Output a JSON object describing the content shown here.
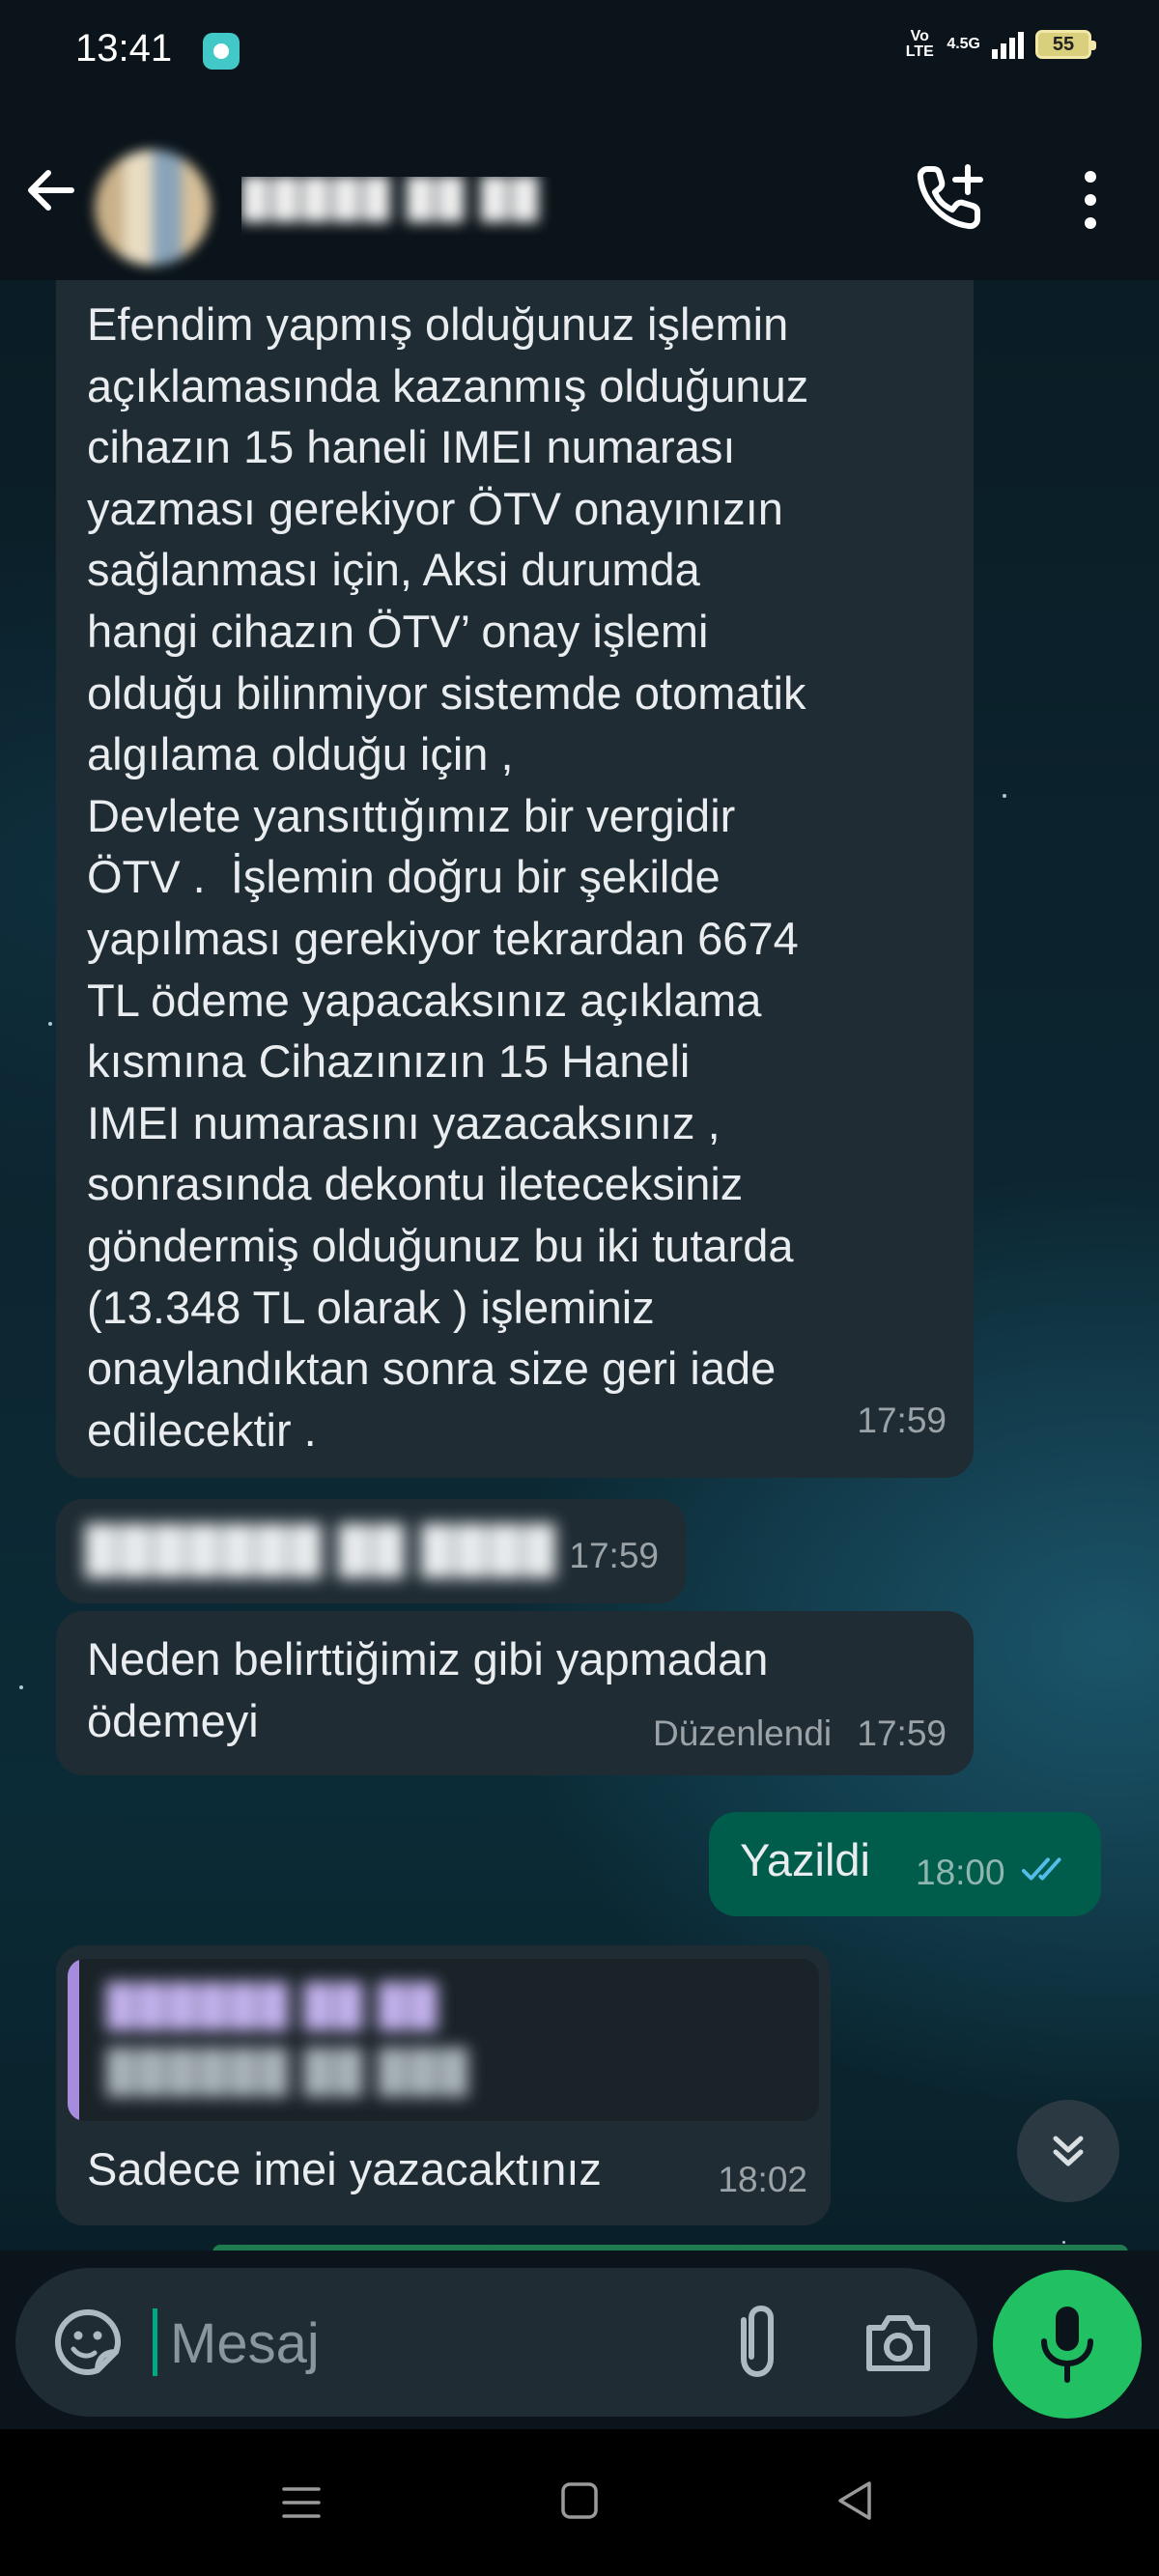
{
  "status_bar": {
    "time": "13:41",
    "volte": "Vo LTE",
    "network": "4.5G",
    "battery": "55"
  },
  "header": {
    "contact_name": "█████ ██ ██",
    "avatar_description": "blurred contact avatar"
  },
  "messages": [
    {
      "direction": "incoming",
      "text": "Efendim yapmış olduğunuz işlemin\naçıklamasında kazanmış olduğunuz\ncihazın 15 haneli IMEI numarası\nyazması gerekiyor ÖTV onayınızın\nsağlanması için, Aksi durumda\nhangi cihazın ÖTV’ onay işlemi\nolduğu bilinmiyor sistemde otomatik\nalgılama olduğu için ,\nDevlete yansıttığımız bir vergidir\nÖTV .  İşlemin doğru bir şekilde\nyapılması gerekiyor tekrardan 6674\nTL ödeme yapacaksınız açıklama\nkısmına Cihazınızın 15 Haneli\nIMEI numarasını yazacaksınız ,\nsonrasında dekontu ileteceksiniz\ngöndermiş olduğunuz bu iki tutarda\n(13.348 TL olarak ) işleminiz\nonaylandıktan sonra size geri iade\nedilecektir .",
      "time": "17:59"
    },
    {
      "direction": "incoming",
      "text": "███████ ██ ████",
      "time": "17:59",
      "redacted": true
    },
    {
      "direction": "incoming",
      "text": "Neden belirttiğimiz gibi yapmadan\nödemeyi",
      "edited_label": "Düzenlendi",
      "time": "17:59"
    },
    {
      "direction": "outgoing",
      "text": "Yazildi",
      "time": "18:00",
      "status": "read"
    },
    {
      "direction": "incoming",
      "quote_line_1": "██████ ██ ██",
      "quote_line_2": "██████ ██ ███",
      "text": "Sadece imei yazacaktınız",
      "time": "18:02"
    }
  ],
  "input": {
    "placeholder": "Mesaj"
  },
  "colors": {
    "incoming_bubble": "#202c33",
    "outgoing_bubble": "#005c4b",
    "accent_green": "#21c063",
    "read_ticks": "#53bdeb",
    "quote_bar": "#a78bdc"
  }
}
